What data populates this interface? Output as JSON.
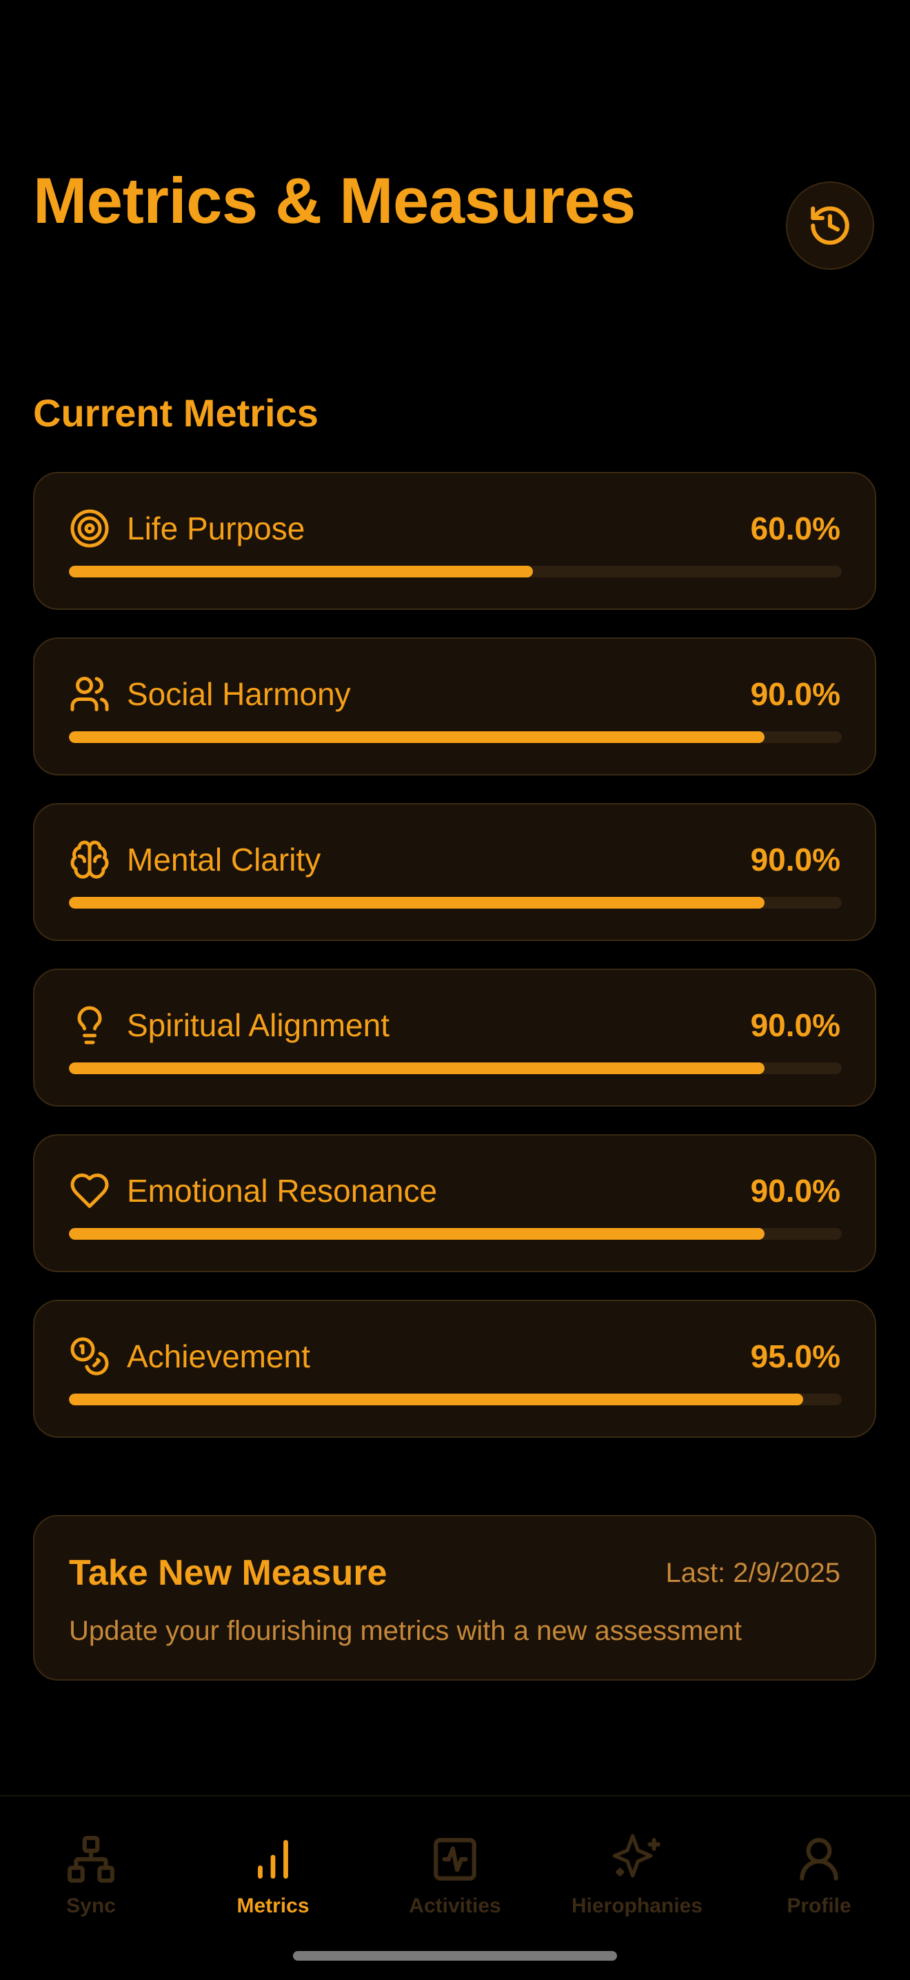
{
  "header": {
    "title": "Metrics & Measures",
    "history_icon": "history-icon"
  },
  "section_title": "Current Metrics",
  "metrics": [
    {
      "label": "Life Purpose",
      "value": "60.0%",
      "fraction": 0.6,
      "icon": "target-icon"
    },
    {
      "label": "Social Harmony",
      "value": "90.0%",
      "fraction": 0.9,
      "icon": "users-icon"
    },
    {
      "label": "Mental Clarity",
      "value": "90.0%",
      "fraction": 0.9,
      "icon": "brain-icon"
    },
    {
      "label": "Spiritual Alignment",
      "value": "90.0%",
      "fraction": 0.9,
      "icon": "lightbulb-icon"
    },
    {
      "label": "Emotional Resonance",
      "value": "90.0%",
      "fraction": 0.9,
      "icon": "heart-icon"
    },
    {
      "label": "Achievement",
      "value": "95.0%",
      "fraction": 0.95,
      "icon": "coins-icon"
    }
  ],
  "measure": {
    "title": "Take New Measure",
    "last": "Last: 2/9/2025",
    "description": "Update your flourishing metrics with a new assessment"
  },
  "tabs": [
    {
      "label": "Sync",
      "icon": "network-icon",
      "active": false
    },
    {
      "label": "Metrics",
      "icon": "bar-chart-icon",
      "active": true
    },
    {
      "label": "Activities",
      "icon": "activity-icon",
      "active": false
    },
    {
      "label": "Hierophanies",
      "icon": "sparkles-icon",
      "active": false
    },
    {
      "label": "Profile",
      "icon": "user-icon",
      "active": false
    }
  ],
  "colors": {
    "accent": "#f5a019",
    "background": "#000000",
    "card": "#1a1108",
    "muted": "#3b2a14"
  }
}
